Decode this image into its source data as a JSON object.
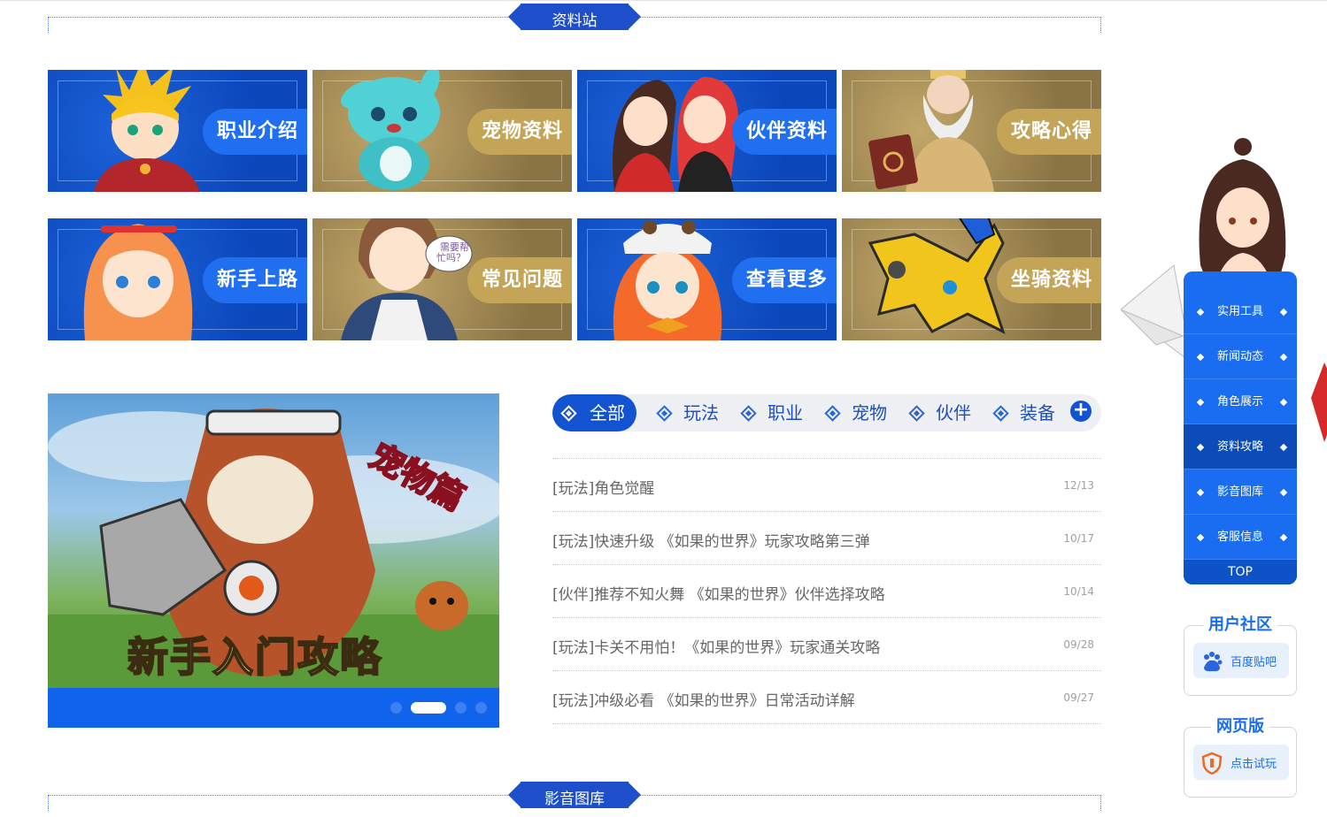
{
  "sections": {
    "top_title": "资料站",
    "bottom_title": "影音图库"
  },
  "tiles": [
    {
      "label": "职业介绍",
      "theme": "blue"
    },
    {
      "label": "宠物资料",
      "theme": "gold"
    },
    {
      "label": "伙伴资料",
      "theme": "blue"
    },
    {
      "label": "攻略心得",
      "theme": "gold"
    },
    {
      "label": "新手上路",
      "theme": "blue"
    },
    {
      "label": "常见问题",
      "theme": "gold"
    },
    {
      "label": "查看更多",
      "theme": "blue"
    },
    {
      "label": "坐骑资料",
      "theme": "gold"
    }
  ],
  "banner": {
    "caption": "新手入门攻略",
    "tag": "宠物篇",
    "slide_count": 4,
    "active_slide": 2
  },
  "tabs": {
    "items": [
      "全部",
      "玩法",
      "职业",
      "宠物",
      "伙伴",
      "装备"
    ],
    "active_index": 0,
    "more_label": "+"
  },
  "news": [
    {
      "title": "[玩法]角色觉醒",
      "date": "12/13"
    },
    {
      "title": "[玩法]快速升级 《如果的世界》玩家攻略第三弹",
      "date": "10/17"
    },
    {
      "title": "[伙伴]推荐不知火舞 《如果的世界》伙伴选择攻略",
      "date": "10/14"
    },
    {
      "title": "[玩法]卡关不用怕！《如果的世界》玩家通关攻略",
      "date": "09/28"
    },
    {
      "title": "[玩法]冲级必看 《如果的世界》日常活动详解",
      "date": "09/27"
    }
  ],
  "side_nav": {
    "items": [
      "实用工具",
      "新闻动态",
      "角色展示",
      "资料攻略",
      "影音图库",
      "客服信息"
    ],
    "active_index": 3,
    "top_label": "TOP"
  },
  "community": {
    "title": "用户社区",
    "button_label": "百度贴吧",
    "icon": "baidu-paw-icon"
  },
  "web_version": {
    "title": "网页版",
    "button_label": "点击试玩",
    "icon": "shield-icon"
  },
  "colors": {
    "primary_blue": "#1153d0",
    "tile_blue": "#0b46bb",
    "tile_gold": "#8a7444",
    "label_gold": "#c4a456",
    "side_blue": "#1a6cf0"
  }
}
